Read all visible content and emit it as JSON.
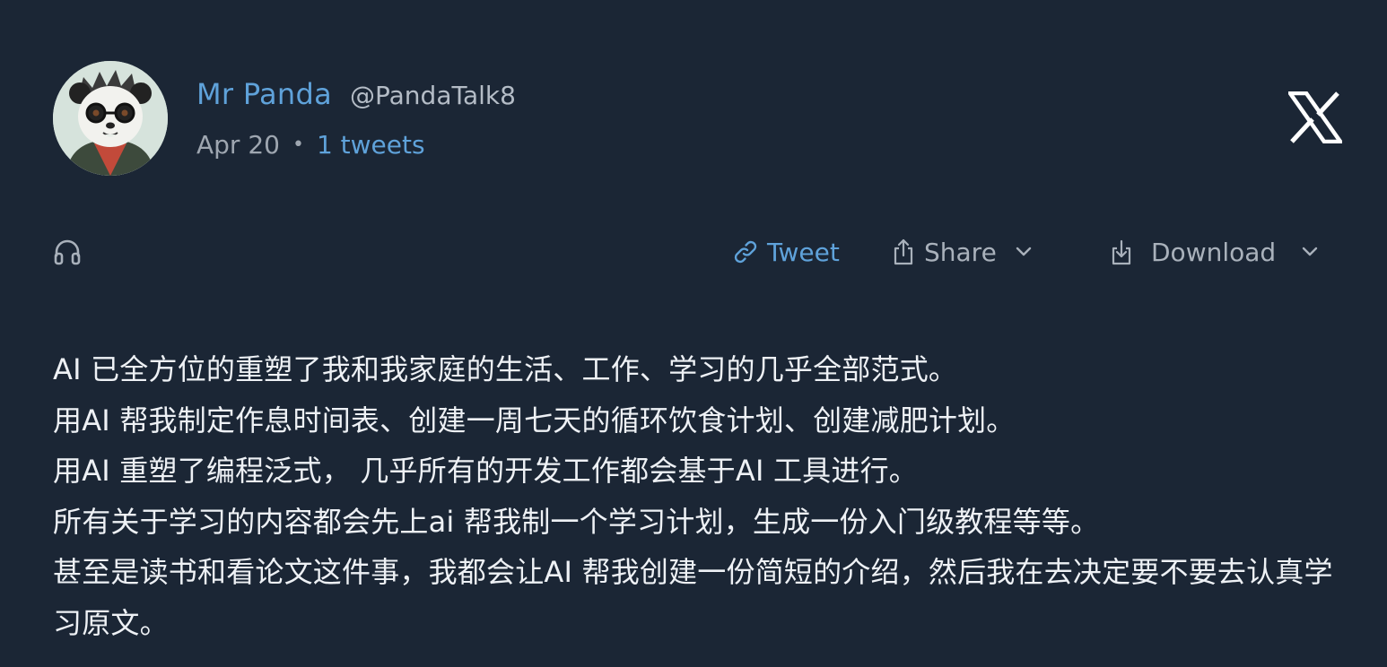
{
  "author": {
    "display_name": "Mr Panda",
    "handle": "@PandaTalk8",
    "avatar_icon": "panda-avatar"
  },
  "meta": {
    "date": "Apr 20",
    "separator": "•",
    "tweet_count": "1 tweets"
  },
  "brand": {
    "logo_icon": "x-logo-icon"
  },
  "actions": {
    "listen_icon": "headphones-icon",
    "tweet_label": "Tweet",
    "share_label": "Share",
    "download_label": "Download"
  },
  "body": {
    "lines": [
      "AI 已全方位的重塑了我和我家庭的生活、工作、学习的几乎全部范式。",
      "用AI 帮我制定作息时间表、创建一周七天的循环饮食计划、创建减肥计划。",
      "用AI 重塑了编程泛式， 几乎所有的开发工作都会基于AI 工具进行。",
      "所有关于学习的内容都会先上ai 帮我制一个学习计划，生成一份入门级教程等等。",
      "甚至是读书和看论文这件事，我都会让AI 帮我创建一份简短的介绍，然后我在去决定要不要去认真学习原文。"
    ]
  },
  "colors": {
    "background": "#1b2635",
    "accent": "#5fa2da",
    "muted": "#a9b1bb",
    "text": "#eef1f5"
  }
}
